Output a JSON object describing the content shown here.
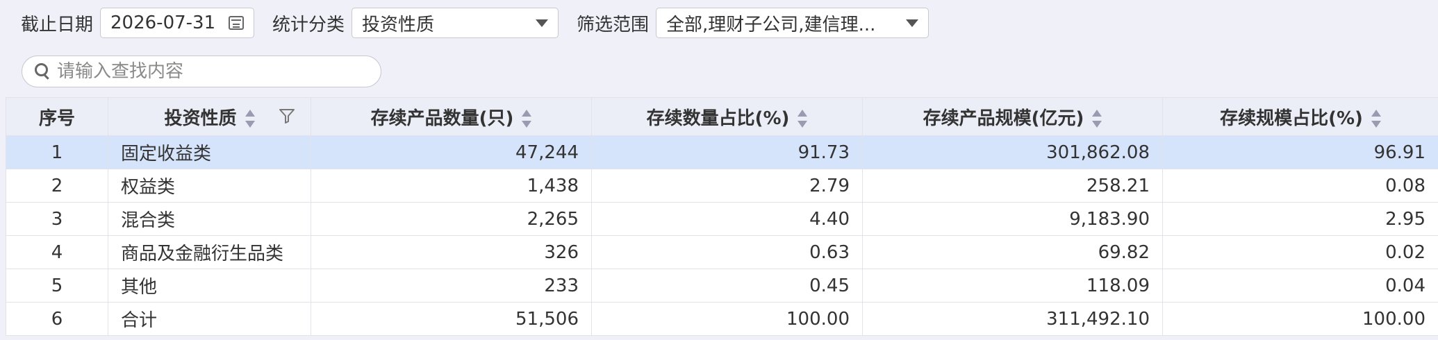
{
  "filters": {
    "date_label": "截止日期",
    "date_value": "2026-07-31",
    "category_label": "统计分类",
    "category_value": "投资性质",
    "scope_label": "筛选范围",
    "scope_value": "全部,理财子公司,建信理..."
  },
  "search": {
    "placeholder": "请输入查找内容"
  },
  "table": {
    "headers": [
      "序号",
      "投资性质",
      "存续产品数量(只)",
      "存续数量占比(%)",
      "存续产品规模(亿元)",
      "存续规模占比(%)"
    ],
    "rows": [
      [
        "1",
        "固定收益类",
        "47,244",
        "91.73",
        "301,862.08",
        "96.91"
      ],
      [
        "2",
        "权益类",
        "1,438",
        "2.79",
        "258.21",
        "0.08"
      ],
      [
        "3",
        "混合类",
        "2,265",
        "4.40",
        "9,183.90",
        "2.95"
      ],
      [
        "4",
        "商品及金融衍生品类",
        "326",
        "0.63",
        "69.82",
        "0.02"
      ],
      [
        "5",
        "其他",
        "233",
        "0.45",
        "118.09",
        "0.04"
      ],
      [
        "6",
        "合计",
        "51,506",
        "100.00",
        "311,492.10",
        "100.00"
      ]
    ]
  }
}
